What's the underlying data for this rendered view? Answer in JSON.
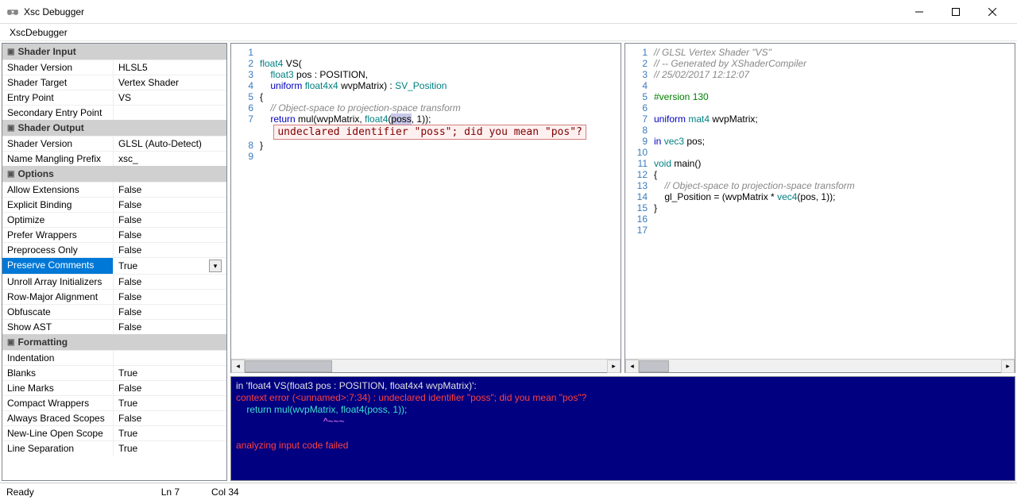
{
  "window": {
    "title": "Xsc Debugger"
  },
  "menu": {
    "item1": "XscDebugger"
  },
  "property_grid": {
    "groups": [
      {
        "title": "Shader Input",
        "rows": [
          {
            "label": "Shader Version",
            "value": "HLSL5"
          },
          {
            "label": "Shader Target",
            "value": "Vertex Shader"
          },
          {
            "label": "Entry Point",
            "value": "VS"
          },
          {
            "label": "Secondary Entry Point",
            "value": ""
          }
        ]
      },
      {
        "title": "Shader Output",
        "rows": [
          {
            "label": "Shader Version",
            "value": "GLSL (Auto-Detect)"
          },
          {
            "label": "Name Mangling Prefix",
            "value": "xsc_"
          }
        ]
      },
      {
        "title": "Options",
        "rows": [
          {
            "label": "Allow Extensions",
            "value": "False"
          },
          {
            "label": "Explicit Binding",
            "value": "False"
          },
          {
            "label": "Optimize",
            "value": "False"
          },
          {
            "label": "Prefer Wrappers",
            "value": "False"
          },
          {
            "label": "Preprocess Only",
            "value": "False"
          },
          {
            "label": "Preserve Comments",
            "value": "True",
            "selected": true,
            "dropdown": true
          },
          {
            "label": "Unroll Array Initializers",
            "value": "False"
          },
          {
            "label": "Row-Major Alignment",
            "value": "False"
          },
          {
            "label": "Obfuscate",
            "value": "False"
          },
          {
            "label": "Show AST",
            "value": "False"
          }
        ]
      },
      {
        "title": "Formatting",
        "rows": [
          {
            "label": "Indentation",
            "value": ""
          },
          {
            "label": "Blanks",
            "value": "True"
          },
          {
            "label": "Line Marks",
            "value": "False"
          },
          {
            "label": "Compact Wrappers",
            "value": "True"
          },
          {
            "label": "Always Braced Scopes",
            "value": "False"
          },
          {
            "label": "New-Line Open Scope",
            "value": "True"
          },
          {
            "label": "Line Separation",
            "value": "True"
          }
        ]
      }
    ]
  },
  "editor_left": {
    "lines": [
      {
        "n": "1",
        "html": ""
      },
      {
        "n": "2",
        "html": "<span class='kw-type'>float4</span> VS("
      },
      {
        "n": "3",
        "html": "    <span class='kw-type'>float3</span> pos : POSITION,"
      },
      {
        "n": "4",
        "html": "    <span class='kw-keyword'>uniform</span> <span class='kw-type'>float4x4</span> wvpMatrix) : <span class='sem'>SV_Position</span>"
      },
      {
        "n": "5",
        "html": "{"
      },
      {
        "n": "6",
        "html": "    <span class='comment'>// Object-space to projection-space transform</span>"
      },
      {
        "n": "7",
        "html": "    <span class='kw-keyword'>return</span> mul(wvpMatrix, <span class='kw-type'>float4</span>(<span class='error-hl'>poss</span>, 1));"
      },
      {
        "n": "",
        "html": "    <span class='error-tooltip'>undeclared identifier \"poss\"; did you mean \"pos\"?</span>"
      },
      {
        "n": "8",
        "html": "}"
      },
      {
        "n": "9",
        "html": ""
      }
    ]
  },
  "editor_right": {
    "lines": [
      {
        "n": "1",
        "html": "<span class='comment'>// GLSL Vertex Shader \"VS\"</span>"
      },
      {
        "n": "2",
        "html": "<span class='comment'>// -- Generated by XShaderCompiler</span>"
      },
      {
        "n": "3",
        "html": "<span class='comment'>// 25/02/2017 12:12:07</span>"
      },
      {
        "n": "4",
        "html": ""
      },
      {
        "n": "5",
        "html": "<span class='kw-directive'>#version 130</span>"
      },
      {
        "n": "6",
        "html": ""
      },
      {
        "n": "7",
        "html": "<span class='kw-keyword'>uniform</span> <span class='kw-type'>mat4</span> wvpMatrix;"
      },
      {
        "n": "8",
        "html": ""
      },
      {
        "n": "9",
        "html": "<span class='kw-keyword'>in</span> <span class='kw-type'>vec3</span> pos;"
      },
      {
        "n": "10",
        "html": ""
      },
      {
        "n": "11",
        "html": "<span class='kw-type'>void</span> main()"
      },
      {
        "n": "12",
        "html": "{"
      },
      {
        "n": "13",
        "html": "    <span class='comment'>// Object-space to projection-space transform</span>"
      },
      {
        "n": "14",
        "html": "    gl_Position = (wvpMatrix * <span class='kw-type'>vec4</span>(pos, 1));"
      },
      {
        "n": "15",
        "html": "}"
      },
      {
        "n": "16",
        "html": ""
      },
      {
        "n": "17",
        "html": ""
      }
    ]
  },
  "console": {
    "line1_hdr": "in 'float4 VS(float3 pos : POSITION, float4x4 wvpMatrix)':",
    "line2_err": "context error (<unnamed>:7:34) : undeclared identifier \"poss\"; did you mean \"pos\"?",
    "line3_code": "    return mul(wvpMatrix, float4(poss, 1));",
    "line4_ptr": "                                 ^~~~",
    "line5_err": "analyzing input code failed"
  },
  "status": {
    "ready": "Ready",
    "line": "Ln 7",
    "col": "Col 34"
  }
}
